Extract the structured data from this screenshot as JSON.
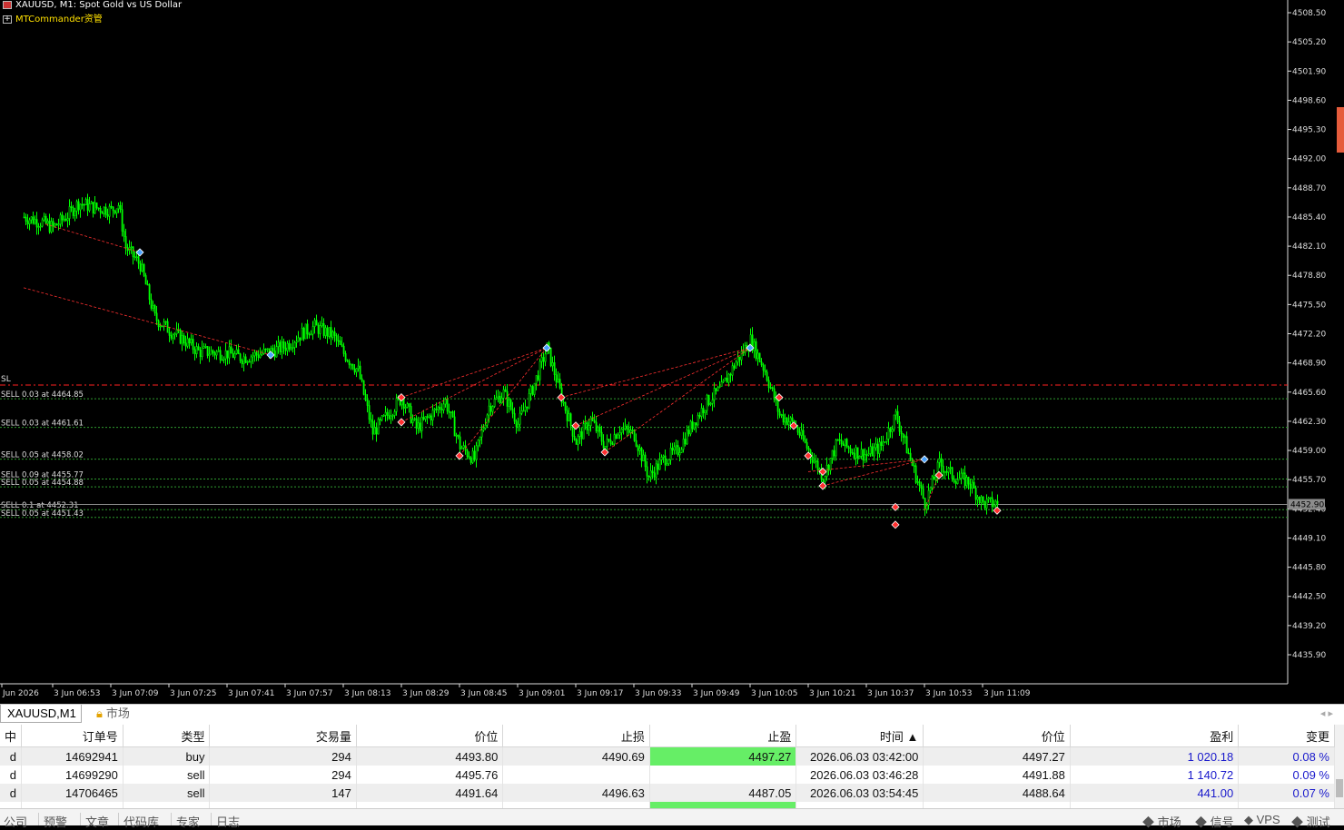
{
  "chart": {
    "title": "XAUUSD, M1:  Spot Gold vs US Dollar",
    "ea_name": "MTCommander资管",
    "price_ticks": [
      "4508.50",
      "4505.20",
      "4501.90",
      "4498.60",
      "4495.30",
      "4492.00",
      "4488.70",
      "4485.40",
      "4482.10",
      "4478.80",
      "4475.50",
      "4472.20",
      "4468.90",
      "4465.60",
      "4462.30",
      "4459.00",
      "4455.70",
      "4452.40",
      "4449.10",
      "4445.80",
      "4442.50",
      "4439.20",
      "4435.90"
    ],
    "time_ticks": [
      "Jun 2026",
      "3 Jun 06:53",
      "3 Jun 07:09",
      "3 Jun 07:25",
      "3 Jun 07:41",
      "3 Jun 07:57",
      "3 Jun 08:13",
      "3 Jun 08:29",
      "3 Jun 08:45",
      "3 Jun 09:01",
      "3 Jun 09:17",
      "3 Jun 09:33",
      "3 Jun 09:49",
      "3 Jun 10:05",
      "3 Jun 10:21",
      "3 Jun 10:37",
      "3 Jun 10:53",
      "3 Jun 11:09"
    ],
    "current_price": "4452.90",
    "sl_label": "SL",
    "order_lines": [
      {
        "label": "SELL 0.03 at 4464.85",
        "price": 4464.85
      },
      {
        "label": "SELL 0.03 at 4461.61",
        "price": 4461.61
      },
      {
        "label": "SELL 0.05 at 4458.02",
        "price": 4458.02
      },
      {
        "label": "SELL 0.09 at 4455.77",
        "price": 4455.77
      },
      {
        "label": "SELL 0.05 at 4454.88",
        "price": 4454.88
      },
      {
        "label": "SELL 0.1 at 4452.31",
        "price": 4452.31
      },
      {
        "label": "SELL 0.05 at 4451.43",
        "price": 4451.43
      }
    ],
    "sl_price": 4466.4,
    "colors": {
      "bull": "#00ff00",
      "bear": "#00ff00",
      "order_line": "#2f9a2f",
      "sl_line": "#ff2020",
      "trade_link": "#ff3030",
      "bid_line": "#8c8c8c"
    },
    "chart_data": {
      "type": "line",
      "symbol": "XAUUSD",
      "timeframe": "M1",
      "ylim": [
        4433.5,
        4510.5
      ],
      "close_path": [
        {
          "t": "06:45",
          "p": 4485.4
        },
        {
          "t": "06:50",
          "p": 4484.8
        },
        {
          "t": "06:53",
          "p": 4484.2
        },
        {
          "t": "06:57",
          "p": 4485.6
        },
        {
          "t": "07:00",
          "p": 4487.0
        },
        {
          "t": "07:04",
          "p": 4486.5
        },
        {
          "t": "07:09",
          "p": 4486.2
        },
        {
          "t": "07:11",
          "p": 4486.8
        },
        {
          "t": "07:13",
          "p": 4482.0
        },
        {
          "t": "07:17",
          "p": 4480.0
        },
        {
          "t": "07:21",
          "p": 4474.0
        },
        {
          "t": "07:25",
          "p": 4472.6
        },
        {
          "t": "07:29",
          "p": 4471.5
        },
        {
          "t": "07:33",
          "p": 4470.2
        },
        {
          "t": "07:41",
          "p": 4470.0
        },
        {
          "t": "07:45",
          "p": 4469.5
        },
        {
          "t": "07:53",
          "p": 4470.2
        },
        {
          "t": "07:57",
          "p": 4470.8
        },
        {
          "t": "08:02",
          "p": 4472.4
        },
        {
          "t": "08:05",
          "p": 4473.0
        },
        {
          "t": "08:10",
          "p": 4472.0
        },
        {
          "t": "08:13",
          "p": 4470.0
        },
        {
          "t": "08:17",
          "p": 4468.0
        },
        {
          "t": "08:21",
          "p": 4461.0
        },
        {
          "t": "08:25",
          "p": 4463.0
        },
        {
          "t": "08:29",
          "p": 4465.0
        },
        {
          "t": "08:33",
          "p": 4461.5
        },
        {
          "t": "08:37",
          "p": 4463.0
        },
        {
          "t": "08:41",
          "p": 4464.6
        },
        {
          "t": "08:45",
          "p": 4459.5
        },
        {
          "t": "08:49",
          "p": 4458.0
        },
        {
          "t": "08:53",
          "p": 4464.0
        },
        {
          "t": "08:57",
          "p": 4465.5
        },
        {
          "t": "09:01",
          "p": 4462.0
        },
        {
          "t": "09:05",
          "p": 4466.0
        },
        {
          "t": "09:09",
          "p": 4470.6
        },
        {
          "t": "09:13",
          "p": 4465.0
        },
        {
          "t": "09:17",
          "p": 4460.0
        },
        {
          "t": "09:21",
          "p": 4462.5
        },
        {
          "t": "09:25",
          "p": 4459.5
        },
        {
          "t": "09:29",
          "p": 4461.5
        },
        {
          "t": "09:33",
          "p": 4460.8
        },
        {
          "t": "09:37",
          "p": 4456.0
        },
        {
          "t": "09:41",
          "p": 4458.0
        },
        {
          "t": "09:45",
          "p": 4459.0
        },
        {
          "t": "09:49",
          "p": 4462.0
        },
        {
          "t": "09:53",
          "p": 4464.5
        },
        {
          "t": "09:57",
          "p": 4466.0
        },
        {
          "t": "10:01",
          "p": 4469.0
        },
        {
          "t": "10:05",
          "p": 4471.5
        },
        {
          "t": "10:09",
          "p": 4468.0
        },
        {
          "t": "10:13",
          "p": 4463.0
        },
        {
          "t": "10:17",
          "p": 4462.0
        },
        {
          "t": "10:21",
          "p": 4459.0
        },
        {
          "t": "10:25",
          "p": 4456.0
        },
        {
          "t": "10:29",
          "p": 4460.0
        },
        {
          "t": "10:33",
          "p": 4459.0
        },
        {
          "t": "10:37",
          "p": 4458.5
        },
        {
          "t": "10:41",
          "p": 4459.5
        },
        {
          "t": "10:45",
          "p": 4463.0
        },
        {
          "t": "10:49",
          "p": 4458.0
        },
        {
          "t": "10:53",
          "p": 4453.0
        },
        {
          "t": "10:57",
          "p": 4457.5
        },
        {
          "t": "11:01",
          "p": 4456.0
        },
        {
          "t": "11:05",
          "p": 4455.5
        },
        {
          "t": "11:09",
          "p": 4453.0
        },
        {
          "t": "11:13",
          "p": 4453.0
        }
      ]
    }
  },
  "tabs": {
    "active": "XAUUSD,M1",
    "market": "市场",
    "arrows": "◂  ▸"
  },
  "table": {
    "headers": [
      "中",
      "订单号",
      "类型",
      "交易量",
      "价位",
      "止损",
      "止盈",
      "时间  ▲",
      "价位",
      "盈利",
      "变更"
    ],
    "rows": [
      {
        "c0": "d",
        "ticket": "14692941",
        "type": "buy",
        "volume": "294",
        "open": "4493.80",
        "sl": "4490.69",
        "tp": "4497.27",
        "time": "2026.06.03 03:42:00",
        "price": "4497.27",
        "profit": "1 020.18",
        "change": "0.08 %",
        "tp_hit": true
      },
      {
        "c0": "d",
        "ticket": "14699290",
        "type": "sell",
        "volume": "294",
        "open": "4495.76",
        "sl": "",
        "tp": "",
        "time": "2026.06.03 03:46:28",
        "price": "4491.88",
        "profit": "1 140.72",
        "change": "0.09 %",
        "tp_hit": false
      },
      {
        "c0": "d",
        "ticket": "14706465",
        "type": "sell",
        "volume": "147",
        "open": "4491.64",
        "sl": "4496.63",
        "tp": "4487.05",
        "time": "2026.06.03 03:54:45",
        "price": "4488.64",
        "profit": "441.00",
        "change": "0.07 %",
        "tp_hit": false
      }
    ]
  },
  "statusbar": {
    "items": [
      "公司",
      "预警",
      "文章",
      "代码库",
      "专家",
      "日志"
    ],
    "right": [
      "市场",
      "信号",
      "VPS",
      "测试"
    ]
  }
}
